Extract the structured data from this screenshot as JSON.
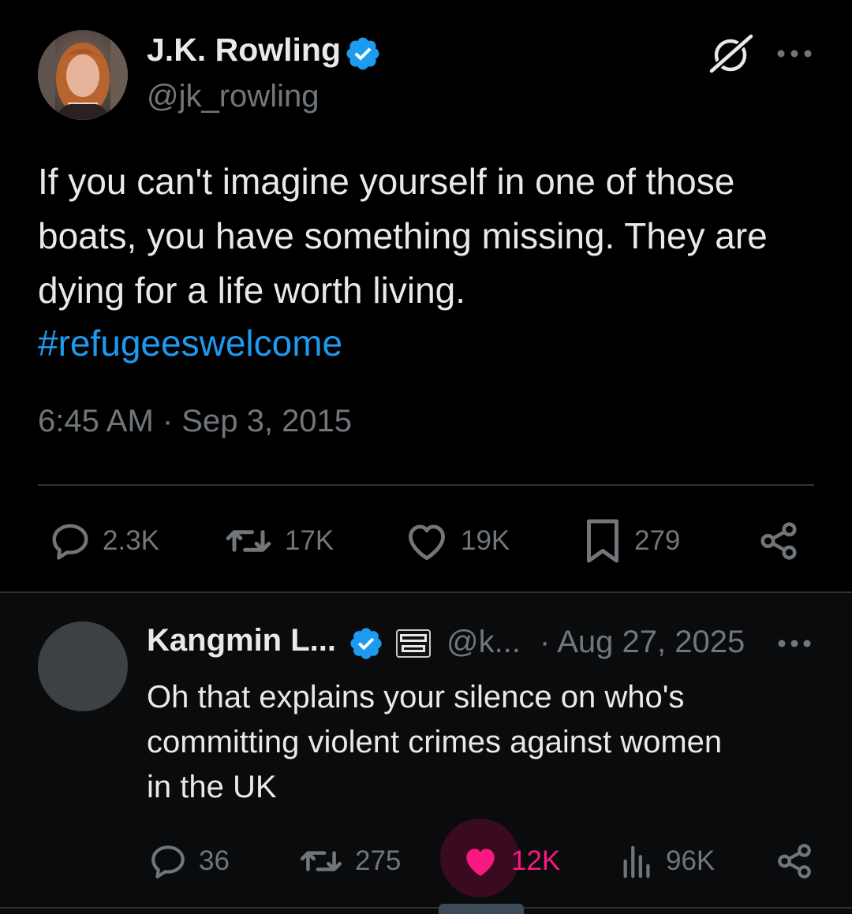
{
  "main_tweet": {
    "author": {
      "display_name": "J.K. Rowling",
      "handle": "@jk_rowling",
      "verified": true
    },
    "text_lines": [
      "If you can't imagine yourself in one of those",
      "boats, you have something missing. They are",
      "dying for a life worth living."
    ],
    "hashtag": "#refugeeswelcome",
    "timestamp": "6:45 AM · Sep 3, 2015",
    "actions": {
      "replies": "2.3K",
      "reposts": "17K",
      "likes": "19K",
      "bookmarks": "279"
    },
    "icons": [
      "grok-icon",
      "more-icon",
      "reply-icon",
      "repost-icon",
      "like-icon",
      "bookmark-icon",
      "share-icon"
    ]
  },
  "reply": {
    "author": {
      "display_name": "Kangmin L...",
      "handle": "@k...",
      "verified": true,
      "affiliate_badge": "BENNY SHOW"
    },
    "date": "· Aug 27, 2025",
    "text_lines": [
      "Oh that explains your silence on who's",
      "committing violent crimes against women",
      "in the UK"
    ],
    "actions": {
      "replies": "36",
      "reposts": "275",
      "likes": "12K",
      "liked": true,
      "views": "96K"
    },
    "icons": [
      "reply-icon",
      "repost-icon",
      "heart-filled-icon",
      "views-icon",
      "share-icon",
      "more-icon"
    ]
  },
  "colors": {
    "background": "#000000",
    "text": "#e7e9ea",
    "secondary": "#71767b",
    "link": "#1d9bf0",
    "verified": "#1d9bf0",
    "like_active": "#f91880",
    "divider": "#2f3336"
  }
}
